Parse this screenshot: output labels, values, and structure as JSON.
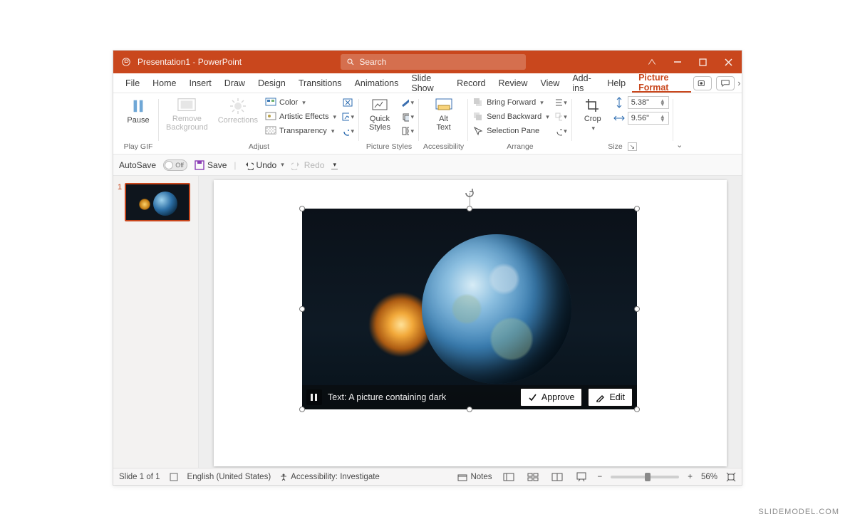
{
  "title": {
    "doc": "Presentation1",
    "app": "PowerPoint",
    "search_placeholder": "Search"
  },
  "tabs": {
    "file": "File",
    "home": "Home",
    "insert": "Insert",
    "draw": "Draw",
    "design": "Design",
    "transitions": "Transitions",
    "animations": "Animations",
    "slideshow": "Slide Show",
    "record": "Record",
    "review": "Review",
    "view": "View",
    "addins": "Add-ins",
    "help": "Help",
    "picture_format": "Picture Format"
  },
  "ribbon": {
    "play_gif": {
      "pause": "Pause",
      "group_label": "Play GIF"
    },
    "adjust": {
      "remove_bg": "Remove\nBackground",
      "corrections": "Corrections",
      "color": "Color",
      "artistic": "Artistic Effects",
      "transparency": "Transparency",
      "group_label": "Adjust"
    },
    "styles": {
      "quick": "Quick\nStyles",
      "group_label": "Picture Styles"
    },
    "accessibility": {
      "alt": "Alt\nText",
      "group_label": "Accessibility"
    },
    "arrange": {
      "bring_forward": "Bring Forward",
      "send_backward": "Send Backward",
      "selection_pane": "Selection Pane",
      "group_label": "Arrange"
    },
    "size": {
      "crop": "Crop",
      "height": "5.38\"",
      "width": "9.56\"",
      "group_label": "Size"
    }
  },
  "qat": {
    "autosave": "AutoSave",
    "autosave_state": "Off",
    "save": "Save",
    "undo": "Undo",
    "redo": "Redo"
  },
  "thumbnails": {
    "slide1_num": "1"
  },
  "alt_overlay": {
    "caption_prefix": "Text: ",
    "caption": "A picture containing dark",
    "approve": "Approve",
    "edit": "Edit"
  },
  "status": {
    "slide": "Slide 1 of 1",
    "lang": "English (United States)",
    "accessibility": "Accessibility: Investigate",
    "notes": "Notes",
    "zoom": "56%"
  },
  "watermark": "SLIDEMODEL.COM"
}
